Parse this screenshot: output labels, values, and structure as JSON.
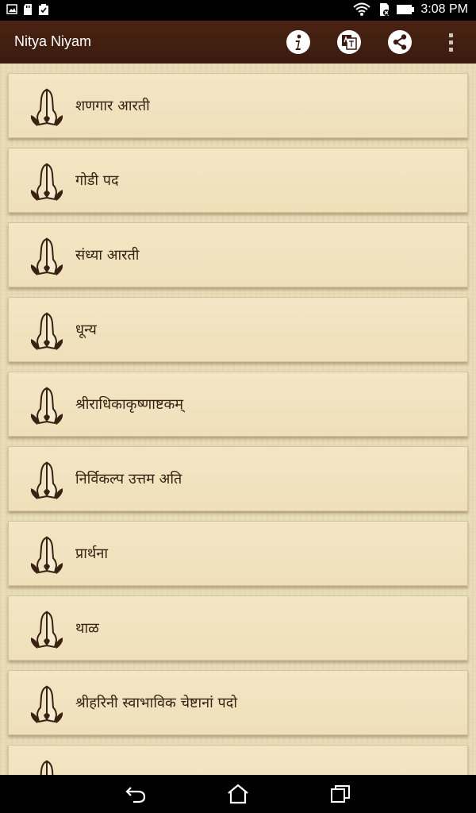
{
  "status_bar": {
    "time": "3:08 PM",
    "icons": [
      "gallery-icon",
      "sd-card-icon",
      "clipboard-check-icon",
      "wifi-icon",
      "sim-off-icon",
      "battery-icon"
    ]
  },
  "app_bar": {
    "title": "Nitya Niyam",
    "actions": [
      "info-icon",
      "language-translate-icon",
      "share-icon",
      "overflow-menu-icon"
    ]
  },
  "list": {
    "items": [
      {
        "label": "शणगार आरती",
        "icon": "praying-hands-icon"
      },
      {
        "label": "गोडी पद",
        "icon": "praying-hands-icon"
      },
      {
        "label": "संध्या आरती",
        "icon": "praying-hands-icon"
      },
      {
        "label": "धून्य",
        "icon": "praying-hands-icon"
      },
      {
        "label": "श्रीराधिकाकृष्णाष्टकम्",
        "icon": "praying-hands-icon"
      },
      {
        "label": "निर्विकल्प उत्तम अति",
        "icon": "praying-hands-icon"
      },
      {
        "label": "प्रार्थना",
        "icon": "praying-hands-icon"
      },
      {
        "label": "थाळ",
        "icon": "praying-hands-icon"
      },
      {
        "label": "श्रीहरिनी स्वाभाविक चेष्टानां पदो",
        "icon": "praying-hands-icon"
      }
    ]
  },
  "nav_bar": {
    "buttons": [
      "back-icon",
      "home-icon",
      "recents-icon"
    ]
  },
  "colors": {
    "app_bar": "#4a2414",
    "list_background": "#e9dcb8",
    "item_background": "#f3e6c4",
    "text": "#3a2212"
  }
}
